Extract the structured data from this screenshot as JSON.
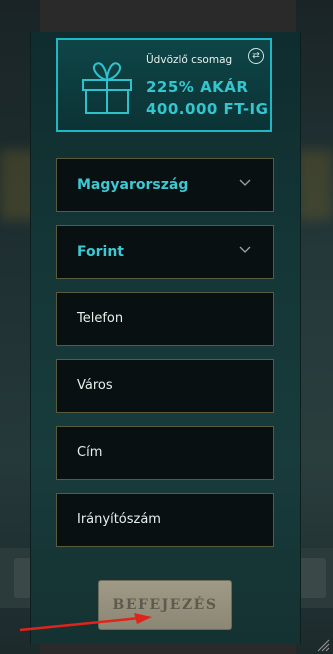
{
  "bonus": {
    "title": "Üdvözlő csomag",
    "line1": "225% AKÁR",
    "line2": "400.000 FT-IG",
    "icon": "gift-icon",
    "swap_icon": "refresh-icon"
  },
  "form": {
    "country": "Magyarország",
    "currency": "Forint",
    "phone_placeholder": "Telefon",
    "city_placeholder": "Város",
    "address_placeholder": "Cím",
    "zip_placeholder": "Irányítószám"
  },
  "finish_label": "BEFEJEZÉS",
  "colors": {
    "accent": "#33c6cf",
    "annotation_arrow": "#e0241b"
  }
}
